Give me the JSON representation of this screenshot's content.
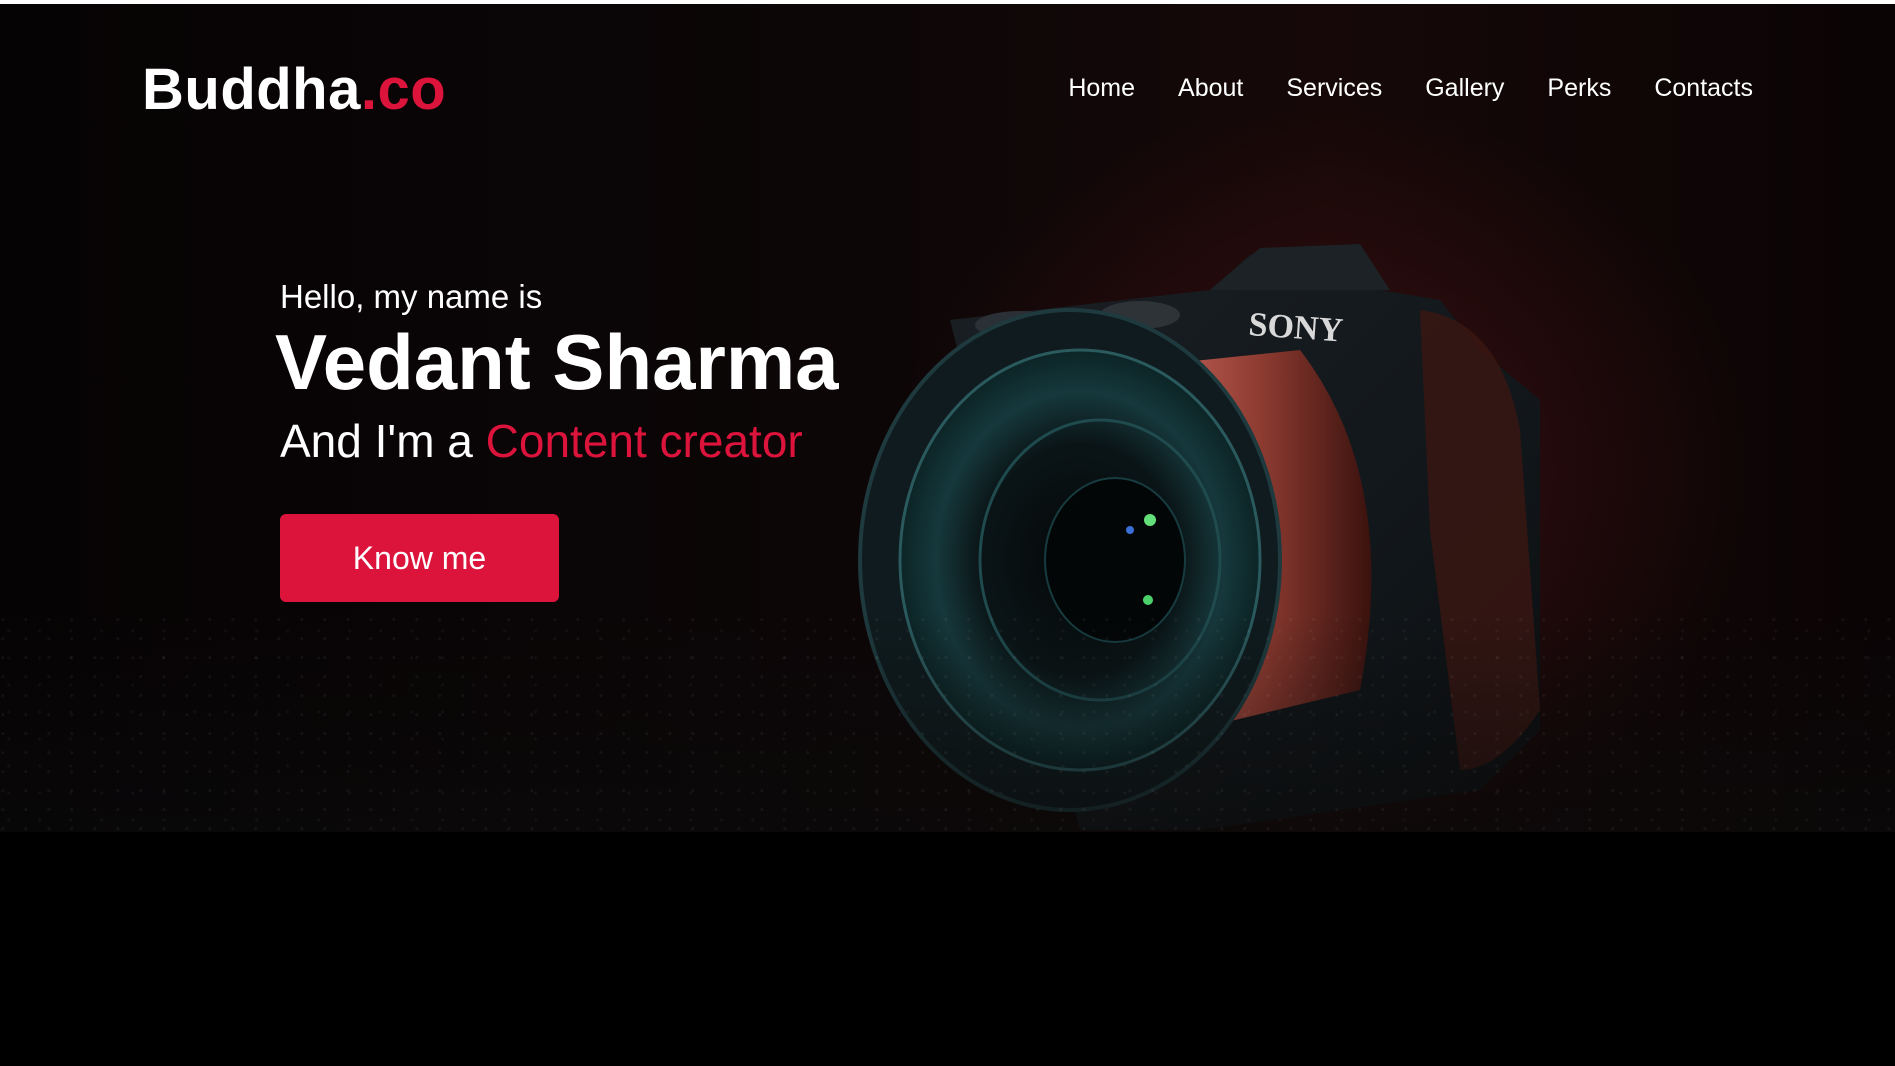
{
  "header": {
    "brand_main": "Buddha",
    "brand_accent": ".co",
    "nav": [
      "Home",
      "About",
      "Services",
      "Gallery",
      "Perks",
      "Contacts"
    ]
  },
  "hero": {
    "greeting": "Hello, my name is",
    "name": "Vedant Sharma",
    "role_prefix": "And I'm a ",
    "role_highlight": "Content creator",
    "cta_label": "Know me",
    "camera_brand": "SONY"
  },
  "colors": {
    "accent": "#dc143c",
    "background": "#000000",
    "text": "#ffffff"
  }
}
